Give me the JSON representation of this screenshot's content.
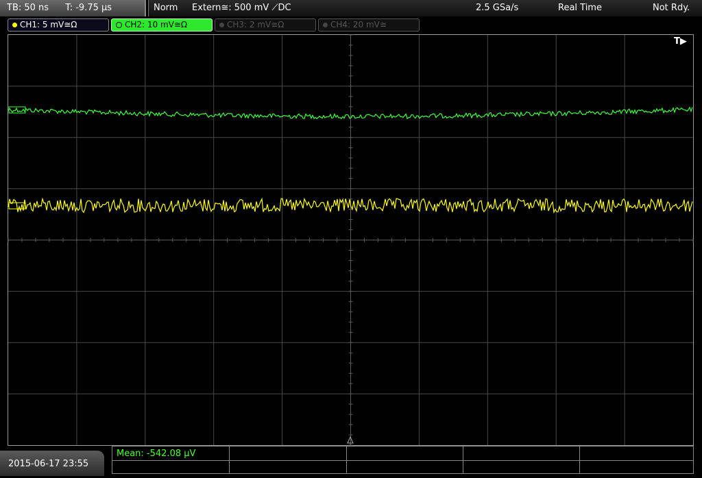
{
  "status": {
    "timebase": "TB: 50 ns",
    "trigger_time": "T: -9.75 µs",
    "mode": "Norm",
    "trigger_source": "Extern≅: 500 mV ⟋DC",
    "sample_rate": "2.5 GSa/s",
    "acq_mode": "Real Time",
    "state": "Not Rdy."
  },
  "channels": [
    {
      "label": "CH1: 5 mV≅Ω",
      "color": "#ffff00",
      "active": true
    },
    {
      "label": "CH2: 10 mV≅Ω",
      "color": "#3cff3c",
      "active": true
    },
    {
      "label": "CH3: 2 mV≅Ω",
      "color": "#555555",
      "active": false
    },
    {
      "label": "CH4: 20 mV≅",
      "color": "#555555",
      "active": false
    }
  ],
  "trigger_marker": "T▶",
  "footer": {
    "datetime": "2015-06-17 23:55",
    "measurement": "Mean: -542.08 µV"
  },
  "colors": {
    "grid": "#4a4a4a",
    "ch1": "#ffff00",
    "ch2": "#3cff3c"
  }
}
